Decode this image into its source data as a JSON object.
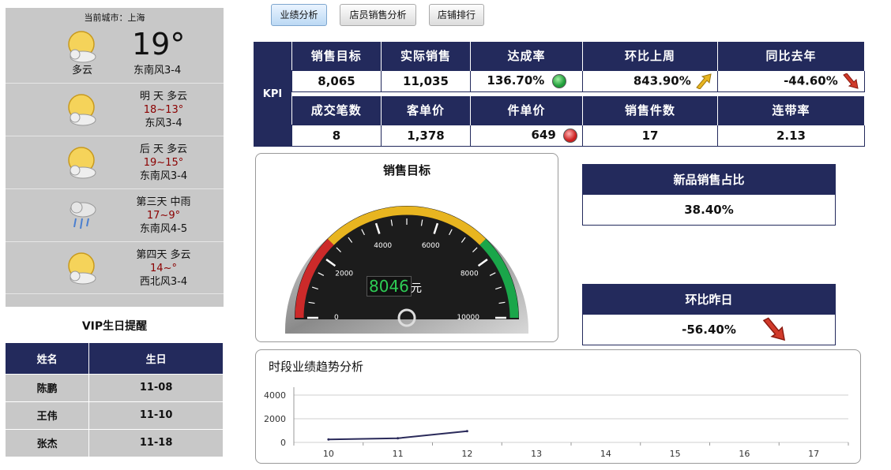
{
  "tabs": [
    {
      "label": "业绩分析"
    },
    {
      "label": "店员销售分析"
    },
    {
      "label": "店铺排行"
    }
  ],
  "weather": {
    "city_label": "当前城市：上海",
    "today": {
      "temp": "19°",
      "desc": "多云",
      "wind": "东南风3-4",
      "icon": "partly-cloudy-icon"
    },
    "forecast": [
      {
        "day": "明 天 多云",
        "temp": "18~13°",
        "wind": "东风3-4",
        "icon": "partly-cloudy-icon"
      },
      {
        "day": "后 天 多云",
        "temp": "19~15°",
        "wind": "东南风3-4",
        "icon": "partly-cloudy-icon"
      },
      {
        "day": "第三天 中雨",
        "temp": "17~9°",
        "wind": "东南风4-5",
        "icon": "rain-icon"
      },
      {
        "day": "第四天 多云",
        "temp": "14~°",
        "wind": "西北风3-4",
        "icon": "partly-cloudy-icon"
      }
    ]
  },
  "vip": {
    "title": "VIP生日提醒",
    "headers": [
      "姓名",
      "生日"
    ],
    "rows": [
      [
        "陈鹏",
        "11-08"
      ],
      [
        "王伟",
        "11-10"
      ],
      [
        "张杰",
        "11-18"
      ]
    ]
  },
  "kpi": {
    "label": "KPI",
    "row1_headers": [
      "销售目标",
      "实际销售",
      "达成率",
      "环比上周",
      "同比去年"
    ],
    "row1_values": [
      "8,065",
      "11,035",
      "136.70%",
      "843.90%",
      "-44.60%"
    ],
    "row2_headers": [
      "成交笔数",
      "客单价",
      "件单价",
      "销售件数",
      "连带率"
    ],
    "row2_values": [
      "8",
      "1,378",
      "649",
      "17",
      "2.13"
    ]
  },
  "gauge": {
    "title": "销售目标",
    "value": 8046,
    "value_text": "8046",
    "unit": "元",
    "min": 0,
    "max": 10000,
    "ticks": [
      "0",
      "2000",
      "4000",
      "6000",
      "8000",
      "10000"
    ]
  },
  "new_product": {
    "title": "新品销售占比",
    "value": "38.40%"
  },
  "vs_yesterday": {
    "title": "环比昨日",
    "value": "-56.40%"
  },
  "colors": {
    "navy": "#232a5c",
    "gauge_red": "#cc2a2a",
    "gauge_yellow": "#e8b520",
    "gauge_green": "#1aa64a",
    "line": "#2a2a5a"
  },
  "chart_data": {
    "type": "line",
    "title": "时段业绩趋势分析",
    "categories": [
      "10",
      "11",
      "12",
      "13",
      "14",
      "15",
      "16",
      "17"
    ],
    "values": [
      250,
      350,
      950,
      null,
      null,
      null,
      null,
      null
    ],
    "ylim": [
      0,
      4000
    ],
    "yticks": [
      "0",
      "2000",
      "4000"
    ],
    "grid": true
  }
}
